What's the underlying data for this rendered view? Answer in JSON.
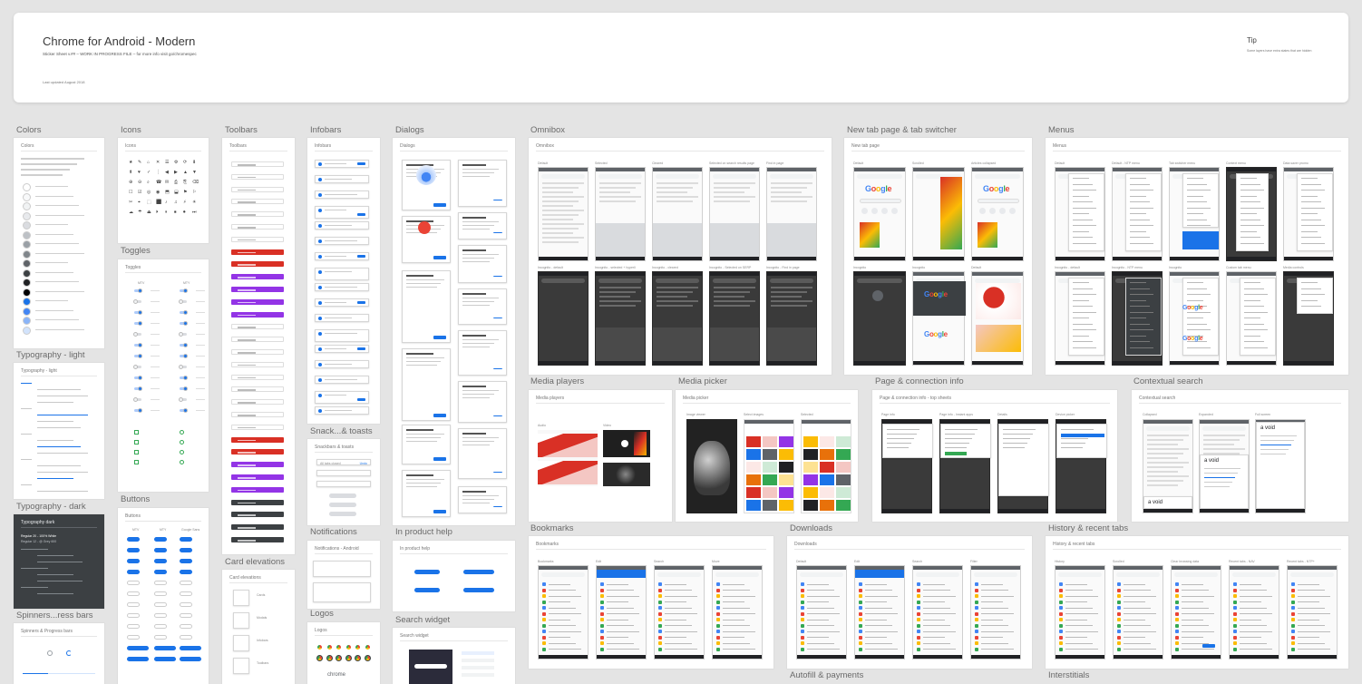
{
  "header": {
    "title": "Chrome for Android - Modern",
    "subtitle": "Sticker Sheet v.## – WORK IN PROGRESS FILE – for more info visit go/chromespec",
    "updated": "Last updated August 2018",
    "tip_title": "Tip",
    "tip_text": "Some layers have extra states that are hidden"
  },
  "sections": {
    "colors": "Colors",
    "icons": "Icons",
    "toolbars": "Toolbars",
    "infobars": "Infobars",
    "dialogs": "Dialogs",
    "omnibox": "Omnibox",
    "new_tab": "New tab page & tab switcher",
    "menus": "Menus",
    "typography_light": "Typography - light",
    "toggles": "Toggles",
    "typography_dark": "Typography - dark",
    "buttons": "Buttons",
    "spinners": "Spinners...ress bars",
    "card_elevations": "Card elevations",
    "snackbars": "Snack...& toasts",
    "notifications": "Notifications",
    "logos": "Logos",
    "in_product_help": "In product help",
    "search_widget": "Search widget",
    "media_players": "Media players",
    "media_picker": "Media picker",
    "page_info": "Page & connection info",
    "contextual_search": "Contextual search",
    "bookmarks": "Bookmarks",
    "downloads": "Downloads",
    "history": "History & recent tabs",
    "autofill": "Autofill & payments",
    "interstitials": "Interstitials"
  },
  "boards": {
    "colors": "Colors",
    "icons": "Icons",
    "toolbars": "Toolbars",
    "infobars": "Infobars",
    "dialogs": "Dialogs",
    "omnibox": "Omnibox",
    "new_tab": "New tab page",
    "menus": "Menus",
    "typography_light": "Typography - light",
    "toggles": "Toggles",
    "typography_dark": "Typography dark",
    "buttons": "Buttons",
    "spinners": "Spinners & Progress bars",
    "card_elevations": "Card elevations",
    "snackbars": "Snackbars & toasts",
    "notifications": "Notifications - Android",
    "logos": "Logos",
    "in_product_help": "In product help",
    "search_widget": "Search widget",
    "media_players": "Media players",
    "media_picker": "Media picker",
    "page_info": "Page & connection info - top sheets",
    "contextual_search": "Contextual search",
    "bookmarks": "Bookmarks",
    "downloads": "Downloads",
    "history": "History & recent tabs"
  },
  "omnibox_captions": [
    "Default",
    "Selected",
    "Cleared",
    "Selected on search results page",
    "Find in page",
    "Incognito - default",
    "Incognito - selected + hyperli",
    "Incognito - cleared",
    "Incognito - Selected on SERP",
    "Incognito - Find in page"
  ],
  "newtab_captions": [
    "Default",
    "Scrolled",
    "Articles collapsed",
    "Incognito",
    "Incognito",
    "Default"
  ],
  "menus_captions": [
    "Default",
    "Default - NTP menu",
    "Tab switcher menu",
    "Context menu",
    "Data saver promo",
    "Incognito - default",
    "Incognito - NTP menu",
    "Incognito",
    "Custom tab menu",
    "Media controls"
  ],
  "media_picker_captions": [
    "Image viewer",
    "Select images",
    "Selected"
  ],
  "media_player_captions": [
    "Audio",
    "Video"
  ],
  "page_info_captions": [
    "Page info",
    "Page info - Instant apps",
    "Details",
    "Device picker"
  ],
  "contextual_captions": [
    "Collapsed",
    "Expanded",
    "Full screen"
  ],
  "bookmark_captions": [
    "Bookmarks",
    "Edit",
    "Search",
    "Move"
  ],
  "download_captions": [
    "Default",
    "Edit",
    "Search",
    "Filter"
  ],
  "history_captions": [
    "History",
    "Scrolled",
    "Clear browsing data",
    "Recent tabs - NAV",
    "Recent tabs - NTP+"
  ],
  "toggle_labels": [
    "MTV",
    "MTY"
  ],
  "button_labels": [
    "MTV",
    "MTY",
    "Google Sans"
  ],
  "typography_dark_lines": [
    "Regular 20 - 100% White",
    "Regular 12 - @ Grey 600"
  ],
  "card_elevation_labels": [
    "Cards",
    "Modals",
    "Infobars",
    "Toolbars"
  ],
  "snackbar_labels": [
    "All tabs closed",
    "Undo"
  ],
  "logos_text": "chrome",
  "google_text": [
    "G",
    "o",
    "o",
    "g",
    "l",
    "e"
  ],
  "contextual_word": "a void",
  "colors_accent": {
    "blue": "#1a73e8",
    "red": "#ea4335",
    "purple": "#9334e6",
    "dark": "#3c4043",
    "green": "#34a853"
  }
}
